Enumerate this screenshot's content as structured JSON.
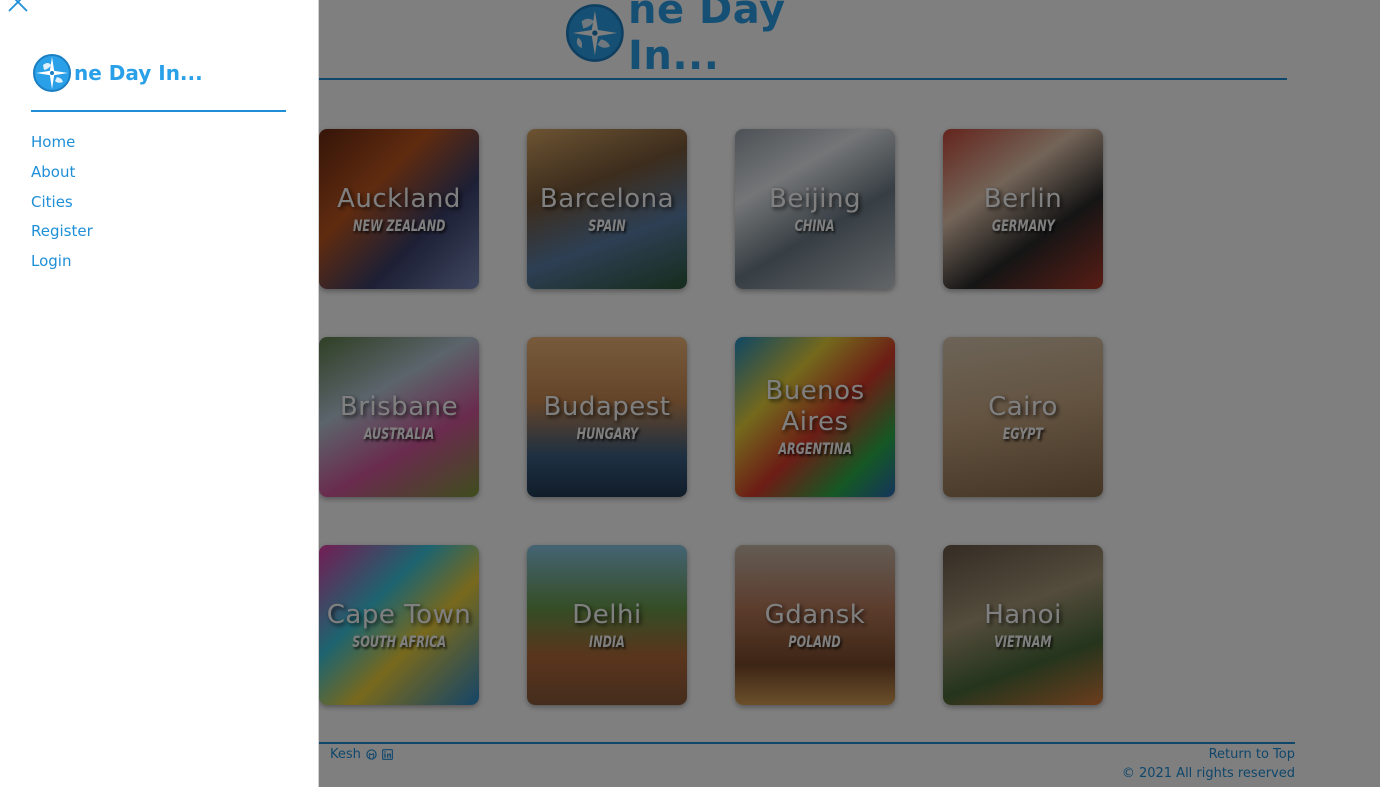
{
  "brand": {
    "name": "ne Day In..."
  },
  "sidebar": {
    "nav": [
      {
        "label": "Home"
      },
      {
        "label": "About"
      },
      {
        "label": "Cities"
      },
      {
        "label": "Register"
      },
      {
        "label": "Login"
      }
    ]
  },
  "cities": [
    {
      "city": "Auckland",
      "country": "New Zealand"
    },
    {
      "city": "Barcelona",
      "country": "Spain"
    },
    {
      "city": "Beijing",
      "country": "China"
    },
    {
      "city": "Berlin",
      "country": "Germany"
    },
    {
      "city": "Brisbane",
      "country": "Australia"
    },
    {
      "city": "Budapest",
      "country": "Hungary"
    },
    {
      "city": "Buenos Aires",
      "country": "Argentina"
    },
    {
      "city": "Cairo",
      "country": "Egypt"
    },
    {
      "city": "Cape Town",
      "country": "South Africa"
    },
    {
      "city": "Delhi",
      "country": "India"
    },
    {
      "city": "Gdansk",
      "country": "Poland"
    },
    {
      "city": "Hanoi",
      "country": "Vietnam"
    }
  ],
  "footer": {
    "author": "Kesh",
    "return_top": "Return to Top",
    "copyright": "© 2021 All rights reserved"
  },
  "icons": {
    "close": "close-icon",
    "logo": "globe-compass-icon",
    "github": "github-icon",
    "linkedin": "linkedin-icon"
  },
  "colors": {
    "accent": "#1f8fd8",
    "overlay": "rgba(0,0,0,0.5)"
  }
}
